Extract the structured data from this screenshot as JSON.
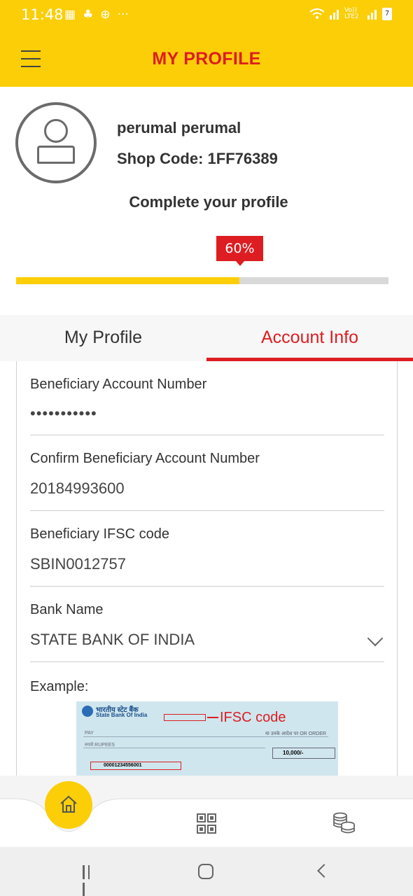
{
  "status_bar": {
    "time": "11:48",
    "left_icons": [
      "▦",
      "♣",
      "⊕",
      "···"
    ],
    "network_label": "Vo)) LTE2",
    "battery": "7"
  },
  "header": {
    "title": "MY PROFILE"
  },
  "profile": {
    "name": "perumal perumal",
    "shop_code": "Shop Code: 1FF76389",
    "complete_label": "Complete your profile",
    "progress_label": "60%",
    "progress_value": 0.6
  },
  "tabs": [
    {
      "label": "My Profile",
      "active": false
    },
    {
      "label": "Account Info",
      "active": true
    }
  ],
  "form": {
    "account_number": {
      "label": "Beneficiary Account Number",
      "value": "•••••••••••"
    },
    "confirm_account": {
      "label": "Confirm Beneficiary Account Number",
      "value": "20184993600"
    },
    "ifsc": {
      "label": "Beneficiary IFSC code",
      "value": "SBIN0012757"
    },
    "bank_name": {
      "label": "Bank Name",
      "value": "STATE BANK OF INDIA"
    },
    "example_label": "Example:"
  },
  "cheque_example": {
    "bank_hindi": "भारतीय स्टेट बैंक",
    "bank_english": "State Bank Of India",
    "ifsc_annotation": "IFSC code",
    "pay_label": "PAY",
    "rupees_label": "रुपये RUPEES",
    "order_label": "या उनके आदेश पर OR ORDER",
    "amount": "10,000/-",
    "account_sample": "00001234556001"
  },
  "bottom_nav": {
    "items": [
      "home-icon",
      "qr-code-icon",
      "coins-icon"
    ]
  },
  "colors": {
    "brand_yellow": "#fbce07",
    "brand_red": "#dd1d21"
  }
}
